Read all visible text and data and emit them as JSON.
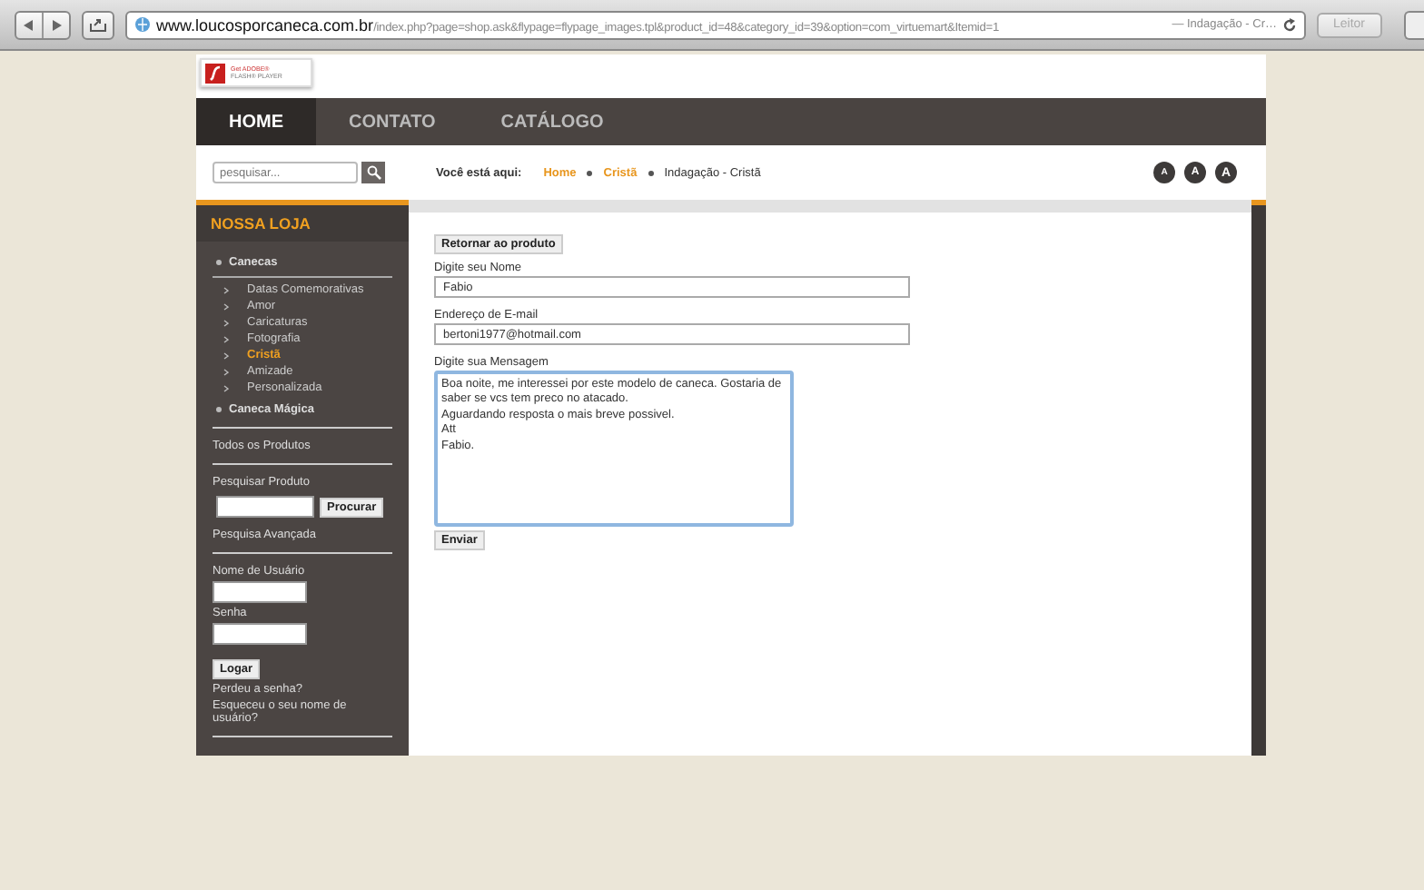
{
  "browser": {
    "url_host": "www.loucosporcaneca.com.br",
    "url_path": "/index.php?page=shop.ask&flypage=flypage_images.tpl&product_id=48&category_id=39&option=com_virtuemart&Itemid=1",
    "page_title": "— Indagação - Cr…",
    "reader_button": "Leitor"
  },
  "flash_badge": {
    "line1": "Get ADOBE®",
    "line2": "FLASH® PLAYER"
  },
  "nav": [
    {
      "label": "HOME",
      "selected": true
    },
    {
      "label": "CONTATO",
      "selected": false
    },
    {
      "label": "CATÁLOGO",
      "selected": false
    }
  ],
  "search": {
    "placeholder": "pesquisar..."
  },
  "breadcrumb": {
    "label": "Você está aqui:",
    "items": [
      {
        "text": "Home",
        "link": true
      },
      {
        "text": "Cristã",
        "link": true
      },
      {
        "text": "Indagação - Cristã",
        "link": false
      }
    ]
  },
  "font_sizes": [
    "A",
    "A",
    "A"
  ],
  "sidebar": {
    "title": "NOSSA LOJA",
    "categories": [
      {
        "label": "Canecas",
        "children": [
          {
            "label": "Datas Comemorativas",
            "selected": false
          },
          {
            "label": "Amor",
            "selected": false
          },
          {
            "label": "Caricaturas",
            "selected": false
          },
          {
            "label": "Fotografia",
            "selected": false
          },
          {
            "label": "Cristã",
            "selected": true
          },
          {
            "label": "Amizade",
            "selected": false
          },
          {
            "label": "Personalizada",
            "selected": false
          }
        ]
      },
      {
        "label": "Caneca Mágica"
      }
    ],
    "all_products": "Todos os Produtos",
    "search_label": "Pesquisar Produto",
    "search_button": "Procurar",
    "advanced": "Pesquisa Avançada",
    "user_label": "Nome de Usuário",
    "password_label": "Senha",
    "login_button": "Logar",
    "forgot_password": "Perdeu a senha?",
    "forgot_user": "Esqueceu o seu nome de usuário?"
  },
  "form": {
    "back_button": "Retornar ao produto",
    "name_label": "Digite seu Nome",
    "name_value": "Fabio",
    "email_label": "Endereço de E-mail",
    "email_value": "bertoni1977@hotmail.com",
    "message_label": "Digite sua Mensagem",
    "message_value": "Boa noite, me interessei por este modelo de caneca. Gostaria de saber se vcs tem preco no atacado.\nAguardando resposta o mais breve possivel.\nAtt\nFabio.",
    "submit_button": "Enviar"
  }
}
